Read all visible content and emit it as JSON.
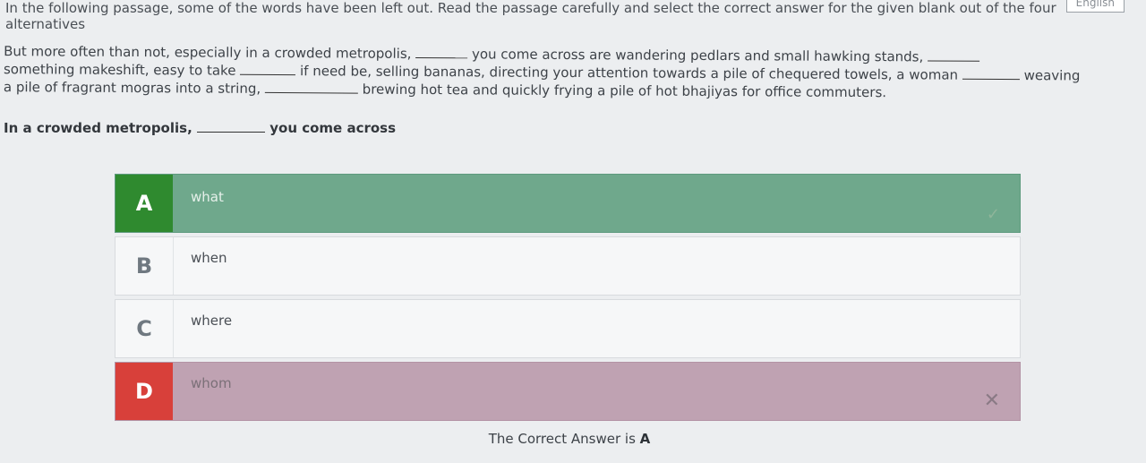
{
  "header": {
    "lang_label": "English"
  },
  "instruction": "In the following passage, some of the words have been left out. Read the passage carefully and select the correct answer for the given blank out of the four alternatives",
  "passage": {
    "line1_a": "But more often than not, especially in a crowded metropolis,",
    "line1_b": "you come across are wandering pedlars and small hawking stands,",
    "line2_a": "something makeshift, easy to take",
    "line2_b": "if need be, selling bananas, directing your attention towards a pile of chequered towels, a woman",
    "line2_c": "weaving",
    "line3_a": "a pile of fragrant mogras into a string,",
    "line3_b": "brewing hot tea and quickly frying a pile of hot bhajiyas for office commuters."
  },
  "question": {
    "prefix": "In a crowded metropolis,",
    "suffix": "you come across"
  },
  "options": [
    {
      "letter": "A",
      "text": "what",
      "state": "correct",
      "mark": "✓"
    },
    {
      "letter": "B",
      "text": "when",
      "state": "neutral",
      "mark": ""
    },
    {
      "letter": "C",
      "text": "where",
      "state": "neutral",
      "mark": ""
    },
    {
      "letter": "D",
      "text": "whom",
      "state": "wrong",
      "mark": "✕"
    }
  ],
  "result": {
    "prefix": "The Correct Answer is",
    "answer": "A"
  },
  "colors": {
    "correct": "#2f8a2f",
    "wrong": "#d8403a"
  }
}
